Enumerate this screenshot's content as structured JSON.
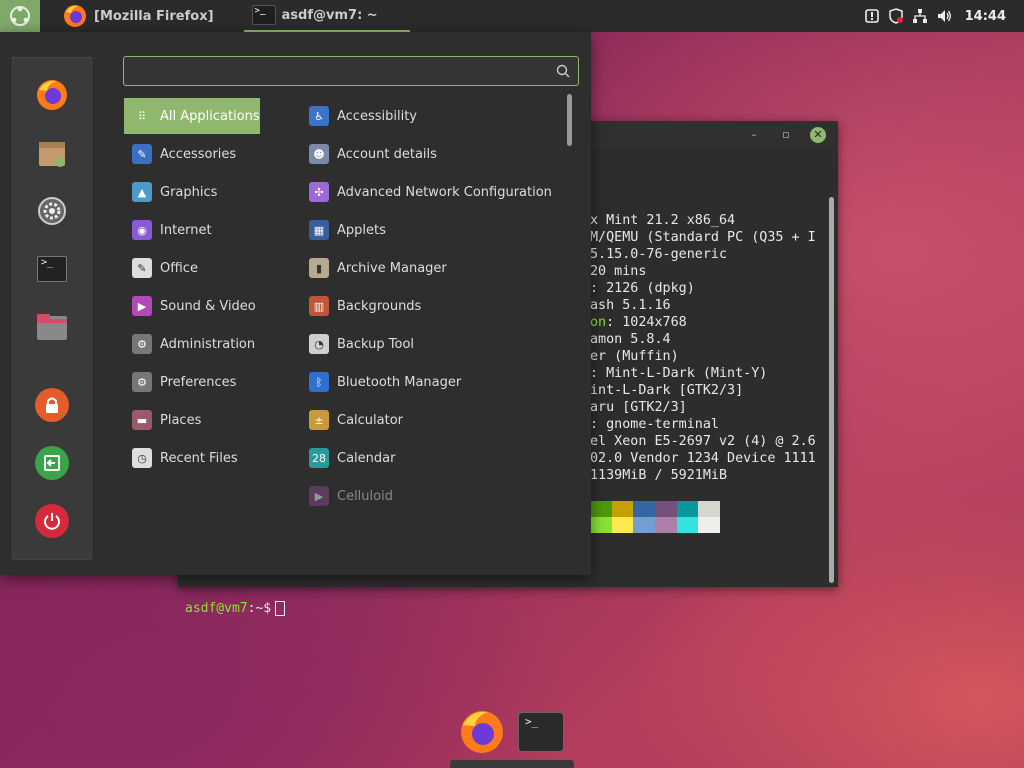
{
  "top_panel": {
    "firefox_window_label": "[Mozilla Firefox]",
    "terminal_window_label": "asdf@vm7: ~",
    "terminal_icon_text": ">_",
    "clock": "14:44"
  },
  "menu": {
    "search_placeholder": "",
    "categories": [
      {
        "label": "All Applications",
        "icon": "grid-icon",
        "active": true
      },
      {
        "label": "Accessories",
        "icon": "accessories-icon"
      },
      {
        "label": "Graphics",
        "icon": "graphics-icon"
      },
      {
        "label": "Internet",
        "icon": "internet-icon"
      },
      {
        "label": "Office",
        "icon": "office-icon"
      },
      {
        "label": "Sound & Video",
        "icon": "sound-video-icon"
      },
      {
        "label": "Administration",
        "icon": "administration-icon"
      },
      {
        "label": "Preferences",
        "icon": "preferences-icon"
      },
      {
        "label": "Places",
        "icon": "folder-icon"
      },
      {
        "label": "Recent Files",
        "icon": "clock-icon"
      }
    ],
    "apps": [
      {
        "label": "Accessibility",
        "icon": "accessibility-icon"
      },
      {
        "label": "Account details",
        "icon": "account-icon"
      },
      {
        "label": "Advanced Network Configuration",
        "icon": "network-icon"
      },
      {
        "label": "Applets",
        "icon": "applets-icon"
      },
      {
        "label": "Archive Manager",
        "icon": "archive-icon"
      },
      {
        "label": "Backgrounds",
        "icon": "backgrounds-icon"
      },
      {
        "label": "Backup Tool",
        "icon": "backup-icon"
      },
      {
        "label": "Bluetooth Manager",
        "icon": "bluetooth-icon"
      },
      {
        "label": "Calculator",
        "icon": "calculator-icon"
      },
      {
        "label": "Calendar",
        "icon": "calendar-icon",
        "icon_text": "28"
      },
      {
        "label": "Celluloid",
        "icon": "celluloid-icon"
      }
    ],
    "favorites": [
      "firefox-icon",
      "software-manager-icon",
      "settings-icon",
      "terminal-icon",
      "files-icon",
      "lock-screen-icon",
      "logout-icon",
      "power-icon"
    ]
  },
  "terminal": {
    "lines": [
      [
        "x Mint 21.2 x86_64",
        ""
      ],
      [
        "M/QEMU (Standard PC (Q35 + I",
        ""
      ],
      [
        "5.15.0-76-generic",
        ""
      ],
      [
        "20 mins",
        ""
      ],
      [
        ": 2126 (dpkg)",
        ""
      ],
      [
        "ash 5.1.16",
        ""
      ],
      [
        "on",
        ": 1024x768"
      ],
      [
        "amon 5.8.4",
        ""
      ],
      [
        "er (Muffin)",
        ""
      ],
      [
        ": Mint-L-Dark (Mint-Y)",
        ""
      ],
      [
        "int-L-Dark [GTK2/3]",
        ""
      ],
      [
        "aru [GTK2/3]",
        ""
      ],
      [
        ": gnome-terminal",
        ""
      ],
      [
        "el Xeon E5-2697 v2 (4) @ 2.6",
        ""
      ],
      [
        "02.0 Vendor 1234 Device 1111",
        ""
      ],
      [
        "1139MiB / 5921MiB",
        ""
      ]
    ],
    "palette_row1": [
      "#4e9a06",
      "#c4a000",
      "#3465a4",
      "#75507b",
      "#06989a",
      "#d3d7cf"
    ],
    "palette_row2": [
      "#8ae234",
      "#fce94f",
      "#729fcf",
      "#ad7fa8",
      "#34e2e2",
      "#eeeeec"
    ],
    "prompt_user": "asdf@vm7",
    "prompt_rest": ":~$"
  },
  "dock": {
    "terminal_icon_text": ">_"
  }
}
